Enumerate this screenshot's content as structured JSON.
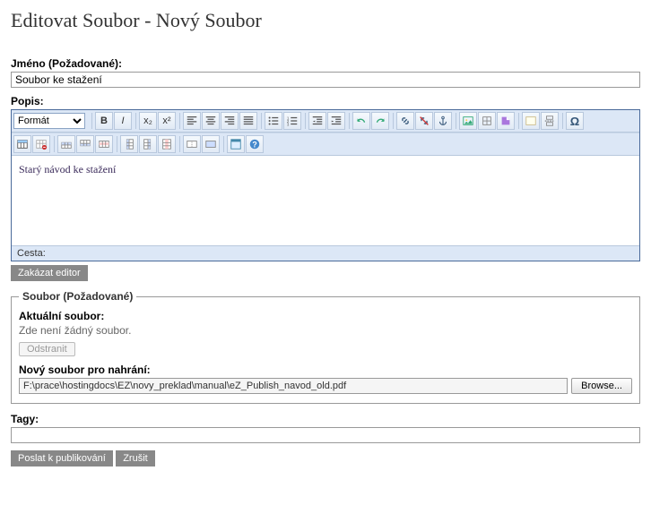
{
  "page": {
    "title": "Editovat Soubor - Nový Soubor"
  },
  "nameField": {
    "label": "Jméno (Požadované):",
    "value": "Soubor ke stažení"
  },
  "descField": {
    "label": "Popis:",
    "formatSelect": "Formát",
    "content": "Starý návod ke stažení",
    "pathLabel": "Cesta:",
    "disableEditorBtn": "Zakázat editor"
  },
  "fileField": {
    "legend": "Soubor (Požadované)",
    "currentLabel": "Aktuální soubor:",
    "currentValue": "Zde není žádný soubor.",
    "removeBtn": "Odstranit",
    "uploadLabel": "Nový soubor pro nahrání:",
    "uploadPath": "F:\\prace\\hostingdocs\\EZ\\novy_preklad\\manual\\eZ_Publish_navod_old.pdf",
    "browseBtn": "Browse..."
  },
  "tagsField": {
    "label": "Tagy:",
    "value": ""
  },
  "actions": {
    "publish": "Poslat k publikování",
    "cancel": "Zrušit"
  },
  "toolbar": {
    "bold": "B",
    "italic": "I",
    "sub": "x₂",
    "sup": "x²"
  }
}
